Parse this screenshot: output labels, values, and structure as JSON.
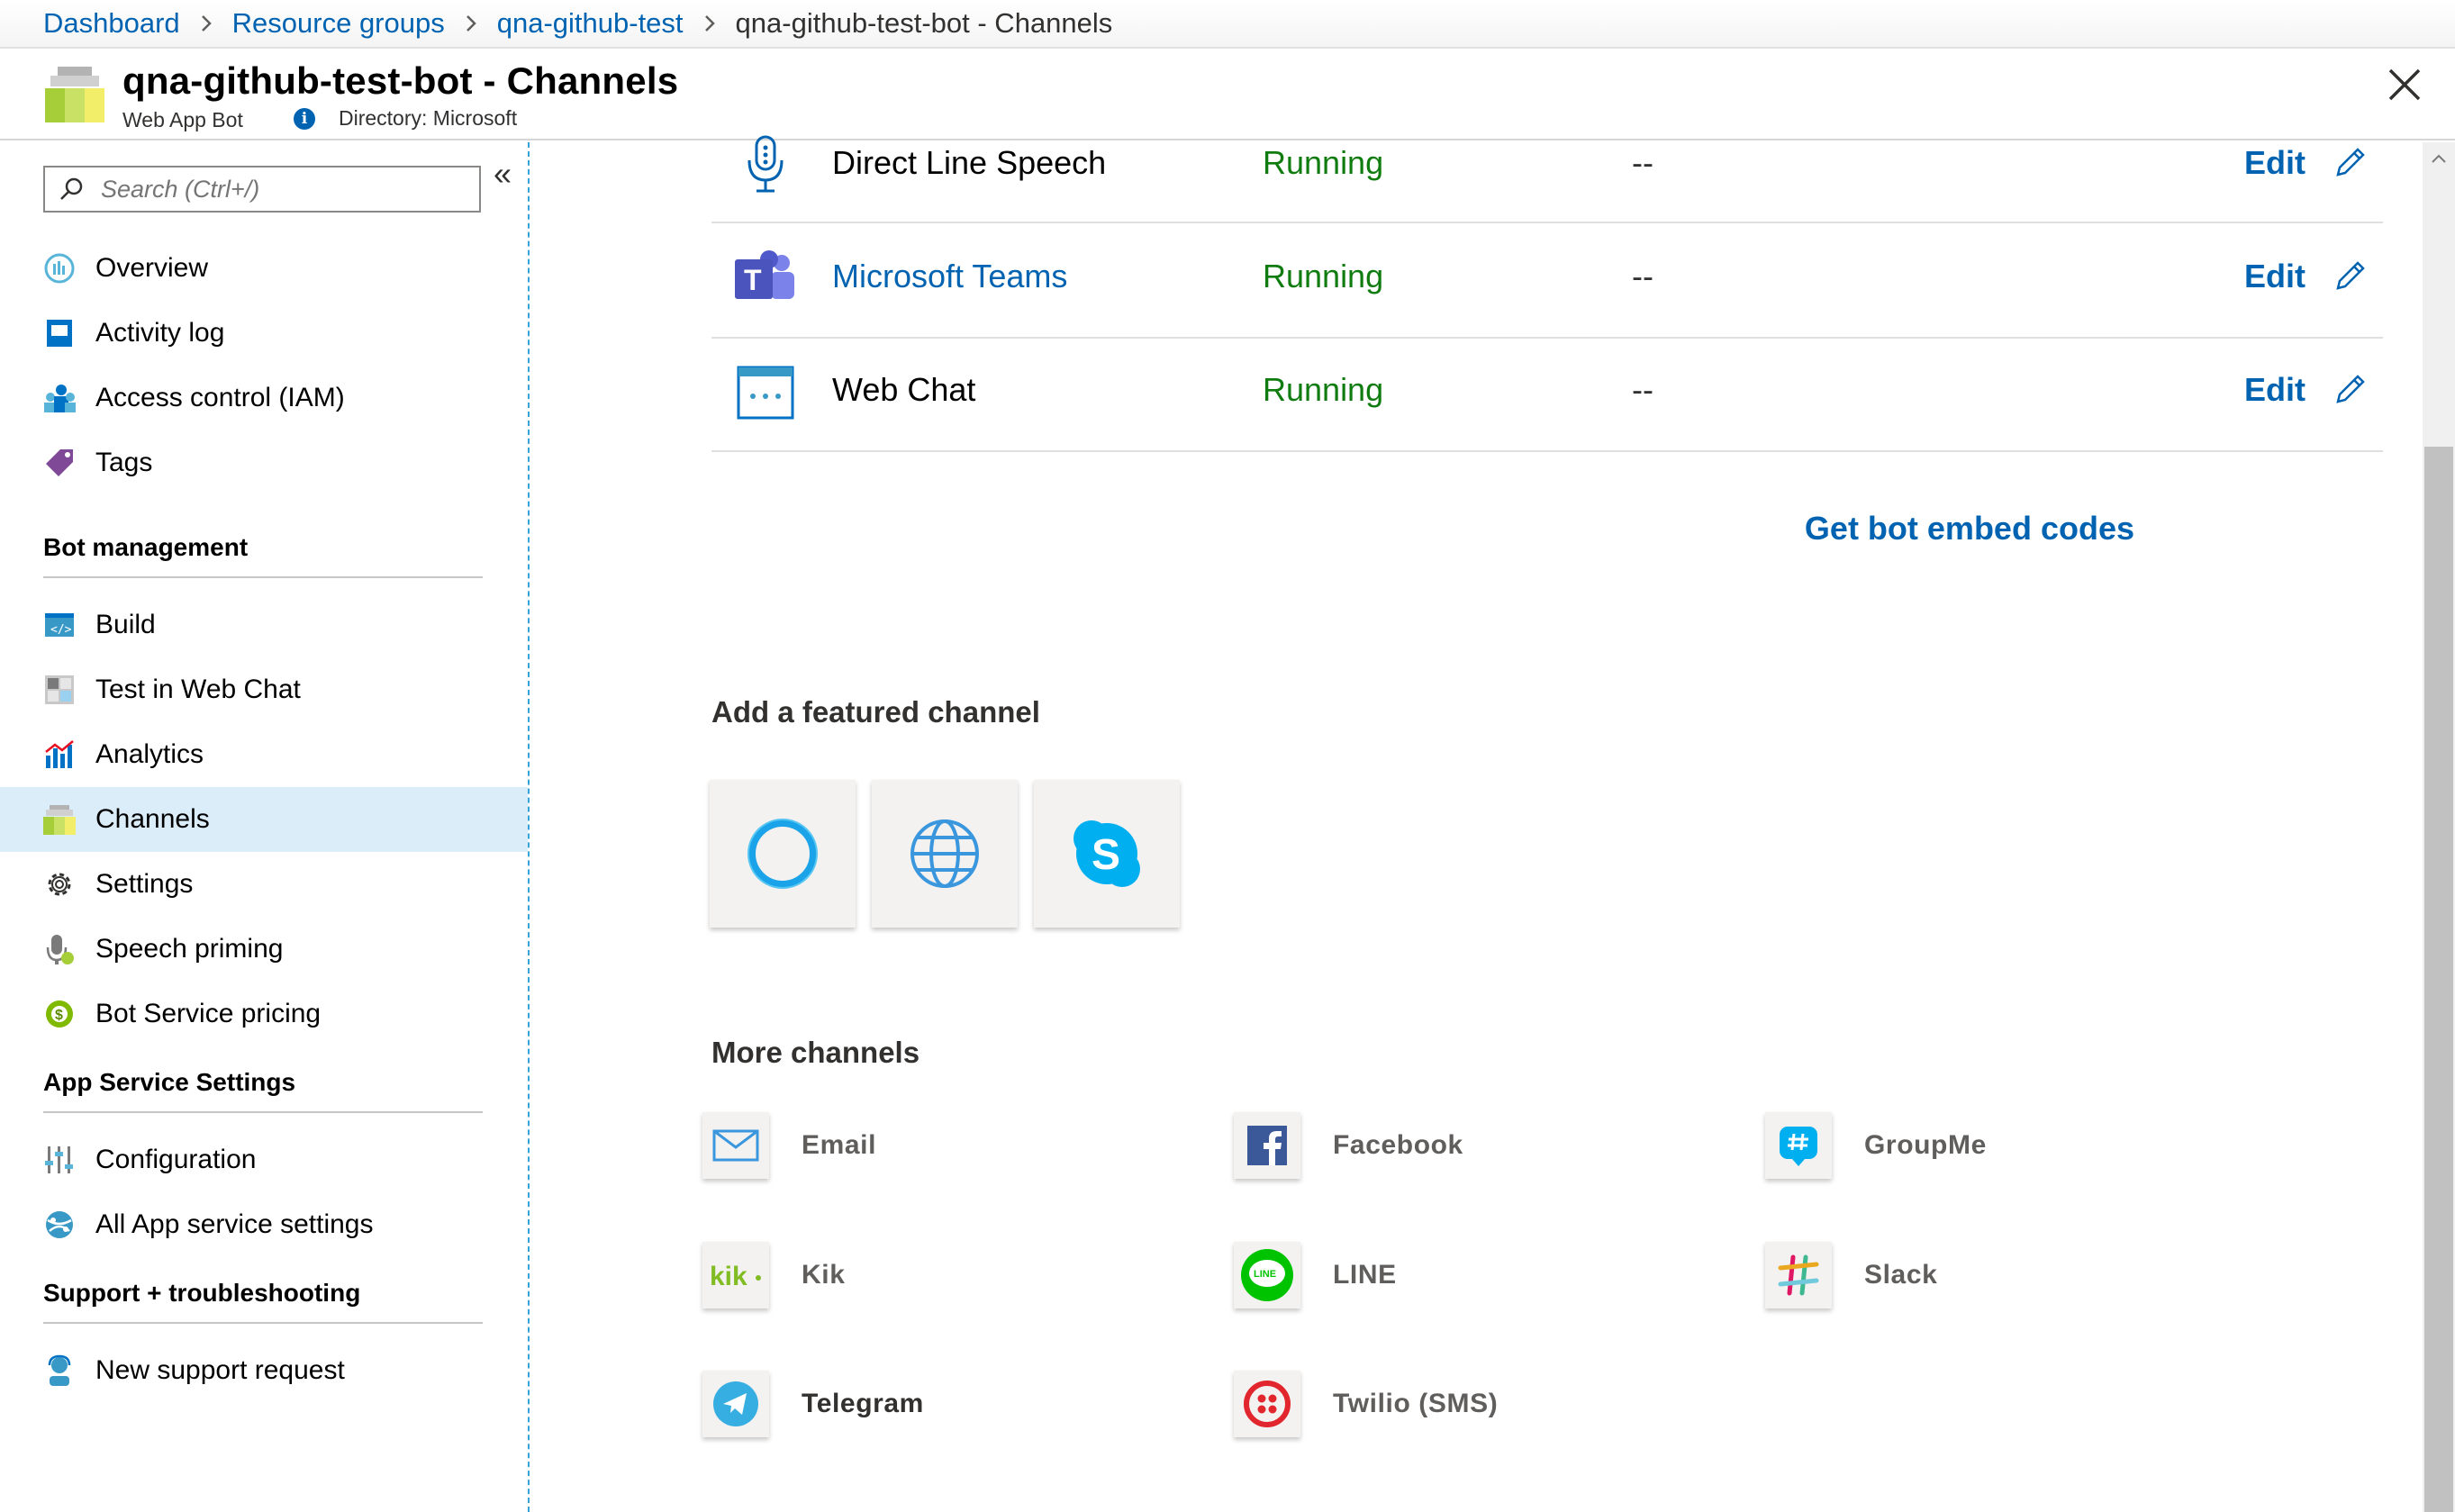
{
  "breadcrumb": {
    "items": [
      "Dashboard",
      "Resource groups",
      "qna-github-test",
      "qna-github-test-bot - Channels"
    ]
  },
  "header": {
    "title": "qna-github-test-bot - Channels",
    "subtitle": "Web App Bot",
    "directory": "Directory: Microsoft",
    "info_glyph": "i"
  },
  "sidebar": {
    "search_placeholder": "Search (Ctrl+/)",
    "collapse_glyph": "«",
    "top_items": [
      {
        "label": "Overview",
        "icon": "overview-icon"
      },
      {
        "label": "Activity log",
        "icon": "activity-log-icon"
      },
      {
        "label": "Access control (IAM)",
        "icon": "access-control-icon"
      },
      {
        "label": "Tags",
        "icon": "tag-icon"
      }
    ],
    "sections": {
      "bot_management": {
        "title": "Bot management",
        "items": [
          {
            "label": "Build",
            "icon": "build-icon"
          },
          {
            "label": "Test in Web Chat",
            "icon": "test-webchat-icon"
          },
          {
            "label": "Analytics",
            "icon": "analytics-icon"
          },
          {
            "label": "Channels",
            "icon": "channels-icon",
            "active": true
          },
          {
            "label": "Settings",
            "icon": "gear-icon"
          },
          {
            "label": "Speech priming",
            "icon": "speech-priming-icon"
          },
          {
            "label": "Bot Service pricing",
            "icon": "pricing-icon"
          }
        ]
      },
      "app_service": {
        "title": "App Service Settings",
        "items": [
          {
            "label": "Configuration",
            "icon": "configuration-icon"
          },
          {
            "label": "All App service settings",
            "icon": "app-service-icon"
          }
        ]
      },
      "support": {
        "title": "Support + troubleshooting",
        "items": [
          {
            "label": "New support request",
            "icon": "support-icon"
          }
        ]
      }
    }
  },
  "channels": [
    {
      "name": "Direct Line Speech",
      "status": "Running",
      "health": "--",
      "action": "Edit",
      "icon": "microphone-icon",
      "is_link": false
    },
    {
      "name": "Microsoft Teams",
      "status": "Running",
      "health": "--",
      "action": "Edit",
      "icon": "teams-icon",
      "is_link": true
    },
    {
      "name": "Web Chat",
      "status": "Running",
      "health": "--",
      "action": "Edit",
      "icon": "web-chat-icon",
      "is_link": false
    }
  ],
  "embed_link": "Get bot embed codes",
  "featured": {
    "title": "Add a featured channel",
    "tiles": [
      "cortana-icon",
      "globe-icon",
      "skype-icon"
    ]
  },
  "more": {
    "title": "More channels",
    "items": [
      {
        "label": "Email",
        "icon": "email-icon"
      },
      {
        "label": "Facebook",
        "icon": "facebook-icon"
      },
      {
        "label": "GroupMe",
        "icon": "groupme-icon"
      },
      {
        "label": "Kik",
        "icon": "kik-icon"
      },
      {
        "label": "LINE",
        "icon": "line-icon"
      },
      {
        "label": "Slack",
        "icon": "slack-icon"
      },
      {
        "label": "Telegram",
        "icon": "telegram-icon"
      },
      {
        "label": "Twilio (SMS)",
        "icon": "twilio-icon"
      }
    ]
  },
  "colors": {
    "link": "#0063b1",
    "running": "#107c10",
    "active_nav": "#dcedfa"
  }
}
